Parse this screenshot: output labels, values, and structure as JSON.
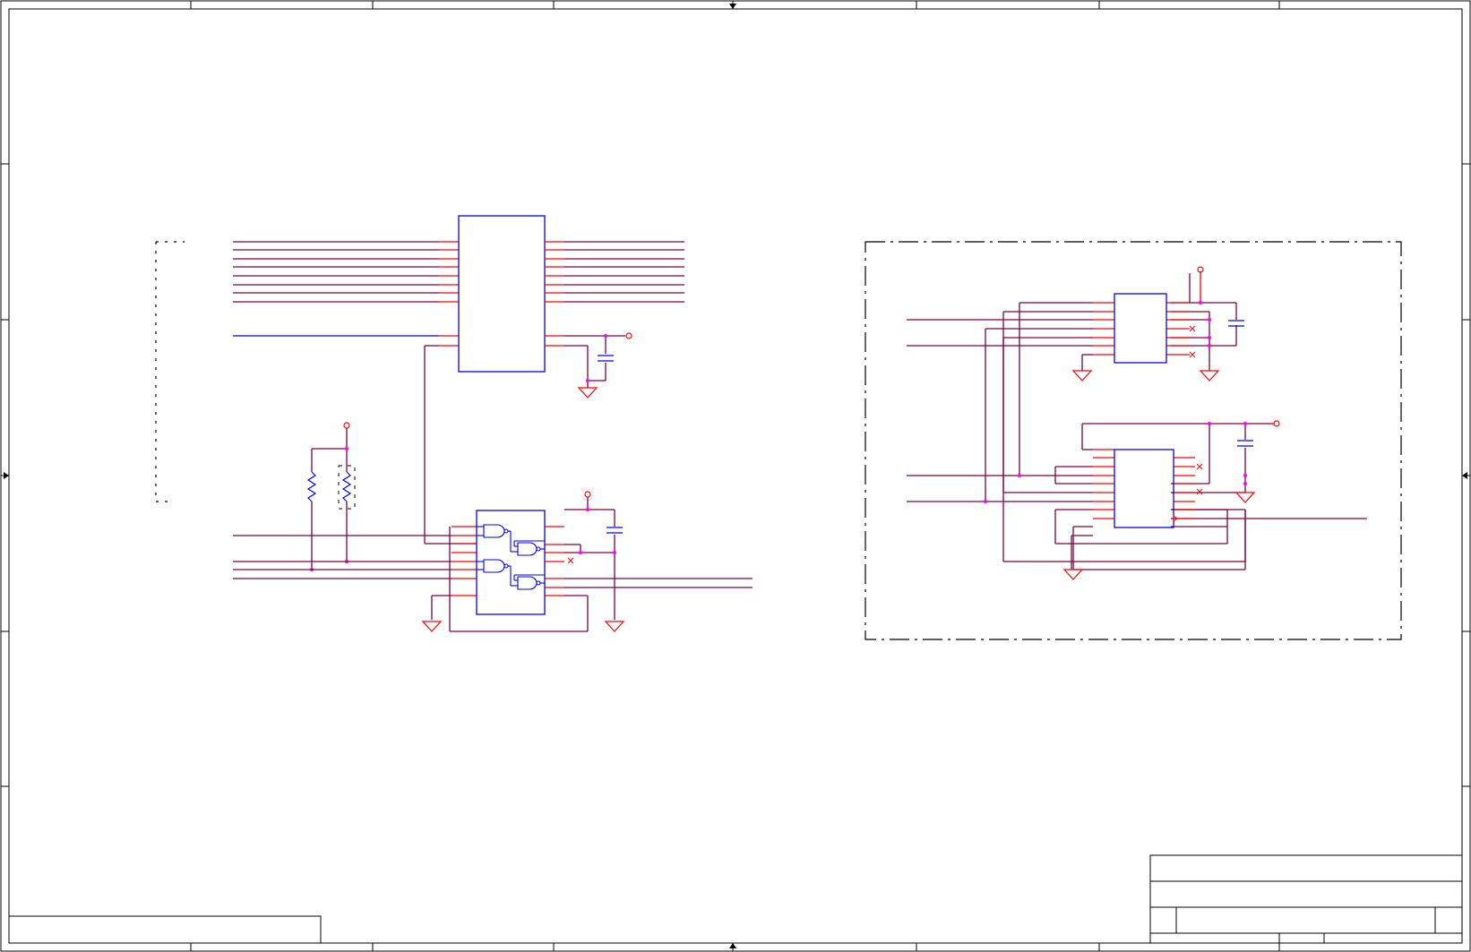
{
  "sheet": {
    "name": "schematic-sheet",
    "colors": {
      "frame": "#000000",
      "wire": "#800040",
      "pin": "#ff0000",
      "body": "#0000ff",
      "junction": "#ff00ff",
      "power": "#ff0000",
      "group": "#000000"
    }
  },
  "components": {
    "buffer_ic": "ic-body",
    "gate_ic": "ic-body",
    "upper_right_ic": "ic-body",
    "lower_right_ic": "ic-body",
    "resistors": "resistor-symbol",
    "capacitors": "capacitor-symbol",
    "grounds": "ground-symbol",
    "power_ports": "power-port-symbol",
    "no_connect": "no-connect-marker"
  },
  "title_block": {
    "title": "",
    "size": "",
    "number": "",
    "revision": "",
    "date": "",
    "sheet": ""
  },
  "notes_box": {
    "text": ""
  }
}
